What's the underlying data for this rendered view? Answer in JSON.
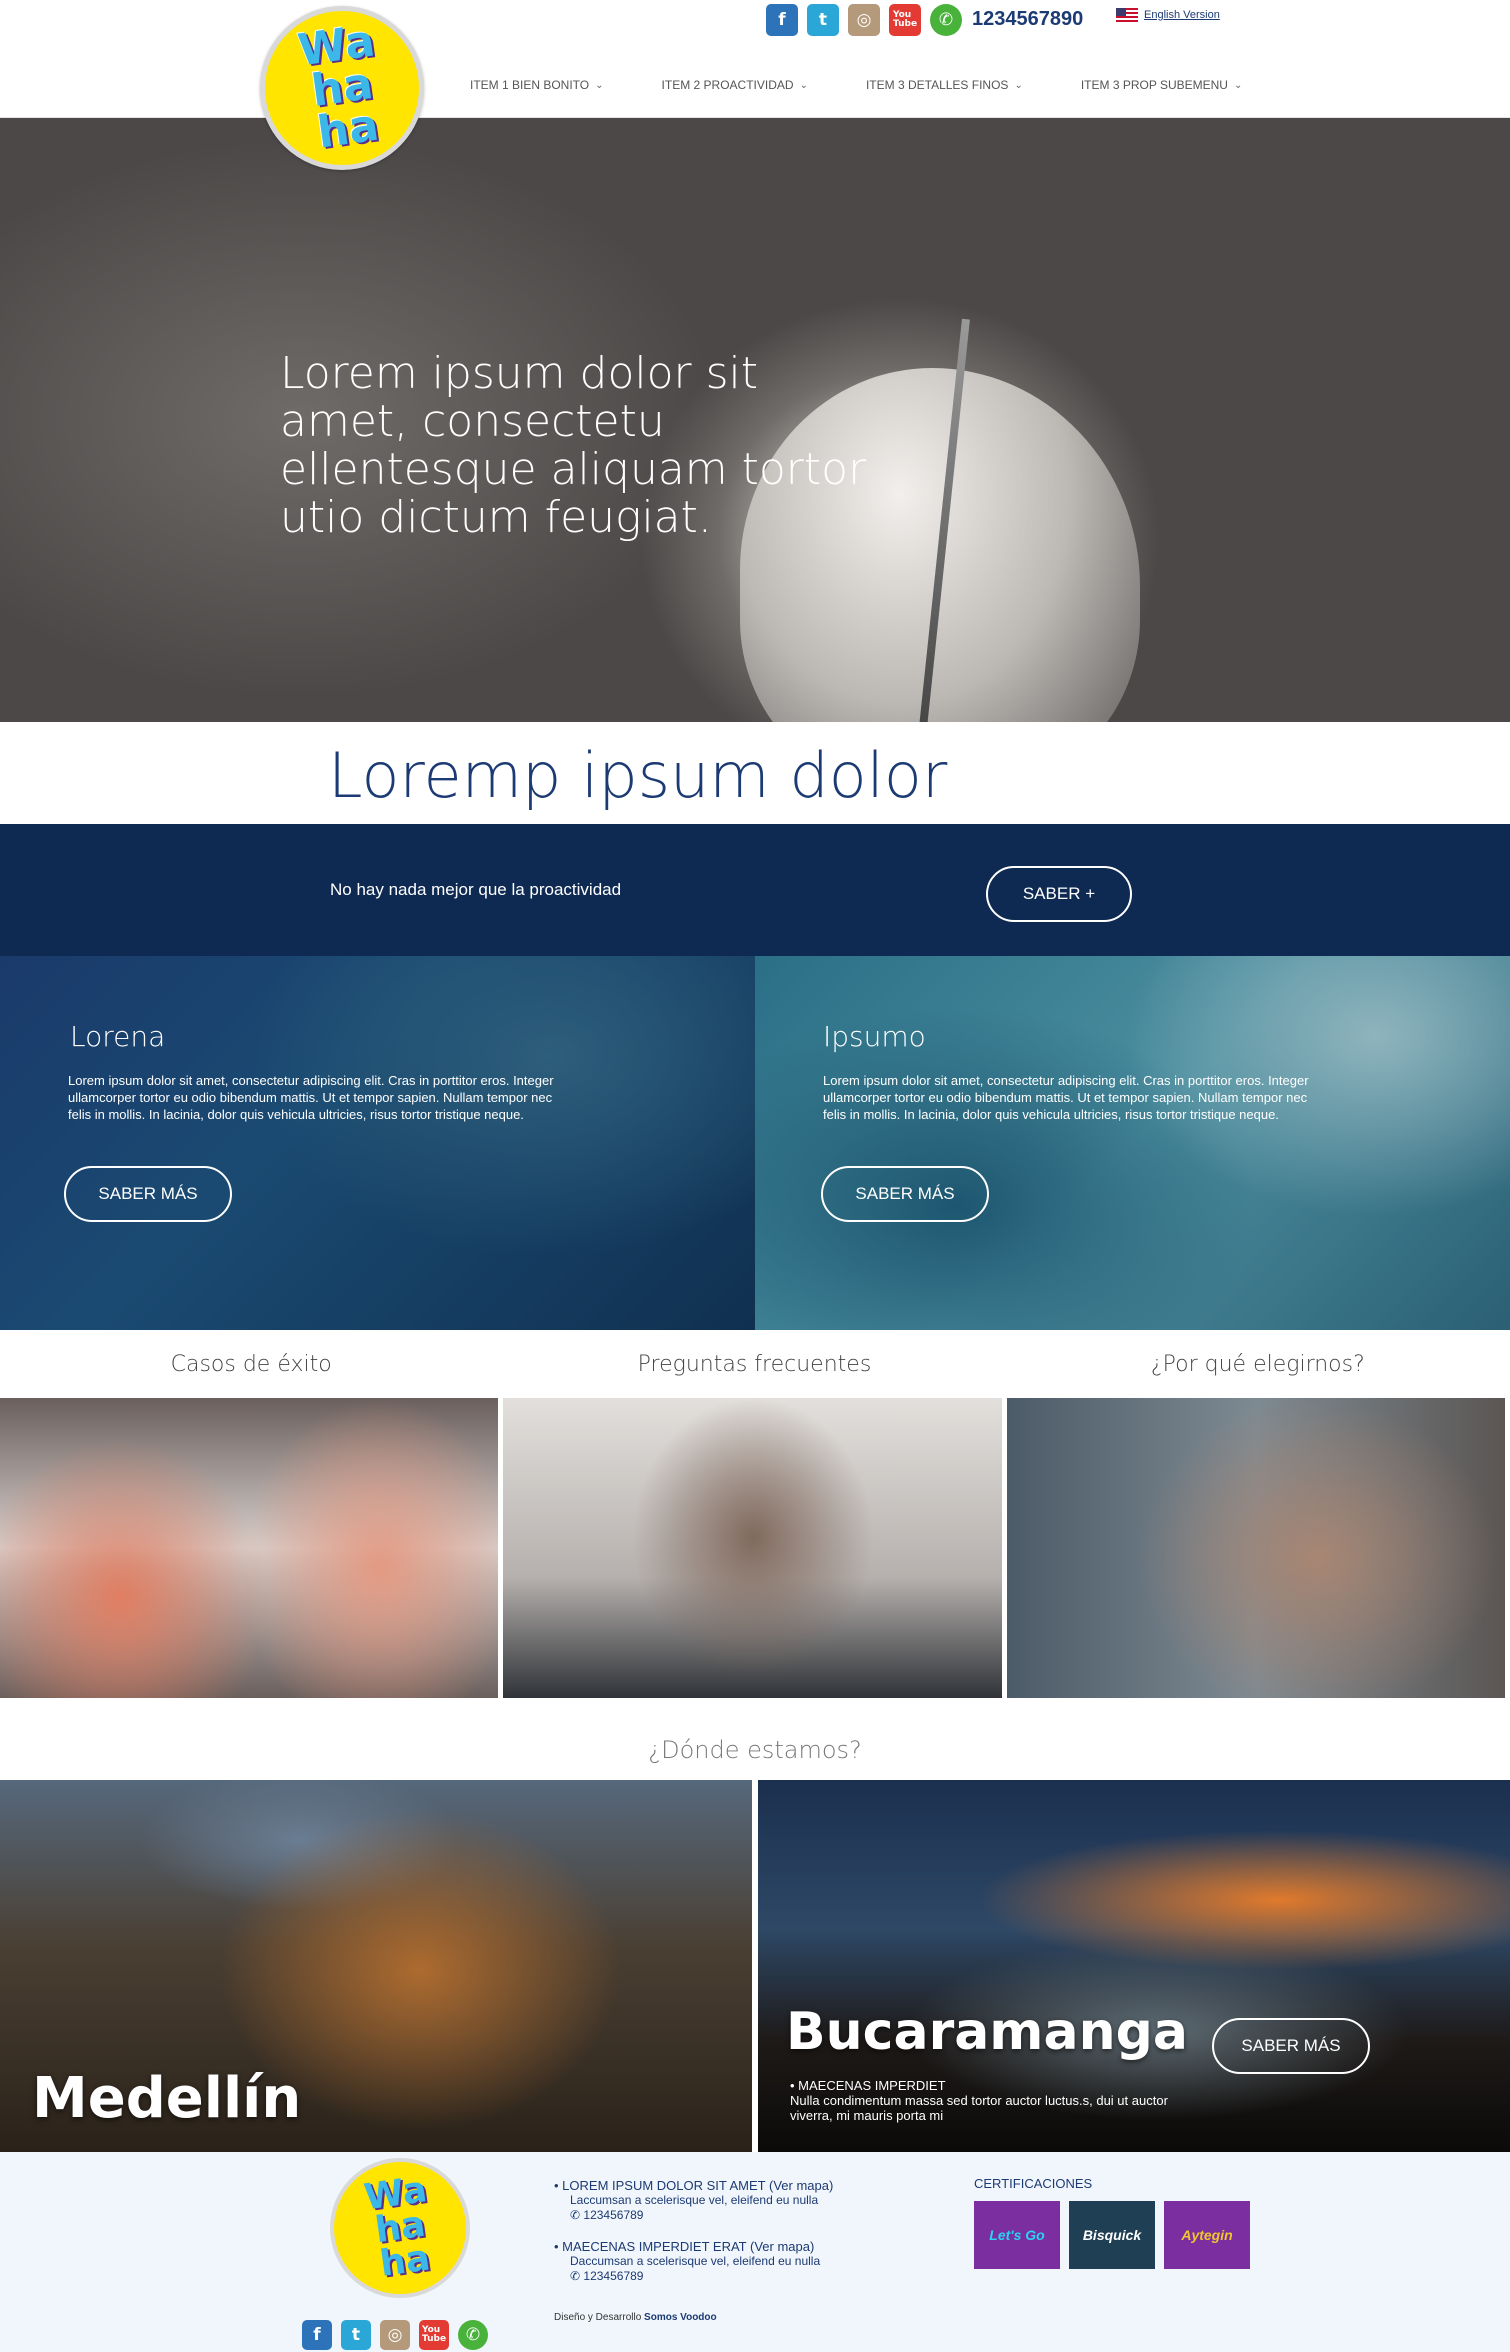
{
  "header": {
    "logo_text": "Wa\nha\nha",
    "phone": "1234567890",
    "language_link": "English Version",
    "social": [
      "facebook-icon",
      "twitter-icon",
      "instagram-icon",
      "youtube-icon",
      "whatsapp-icon"
    ],
    "nav": [
      {
        "label": "ITEM 1 BIEN BONITO"
      },
      {
        "label": "ITEM 2 PROACTIVIDAD"
      },
      {
        "label": "ITEM 3 DETALLES FINOS"
      },
      {
        "label": "ITEM 3 PROP SUBEMENU"
      }
    ]
  },
  "hero": {
    "headline": "Lorem ipsum dolor sit amet, consectetu ellentesque aliquam tortor utio dictum feugiat."
  },
  "section": {
    "title": "Loremp ipsum dolor"
  },
  "cta": {
    "text": "No hay nada mejor que la proactividad",
    "button": "SABER +"
  },
  "panels": [
    {
      "title": "Lorena",
      "body": "Lorem ipsum dolor sit amet, consectetur adipiscing elit. Cras in porttitor eros. Integer ullamcorper tortor eu odio bibendum mattis. Ut et tempor sapien. Nullam tempor nec felis in mollis. In lacinia, dolor quis vehicula ultricies, risus tortor tristique neque.",
      "button": "SABER MÁS"
    },
    {
      "title": "Ipsumo",
      "body": "Lorem ipsum dolor sit amet, consectetur adipiscing elit. Cras in porttitor eros. Integer ullamcorper tortor eu odio bibendum mattis. Ut et tempor sapien. Nullam tempor nec felis in mollis. In lacinia, dolor quis vehicula ultricies, risus tortor tristique neque.",
      "button": "SABER MÁS"
    }
  ],
  "cards": [
    {
      "label": "Casos de éxito"
    },
    {
      "label": "Preguntas frecuentes"
    },
    {
      "label": "¿Por qué elegirnos?"
    }
  ],
  "locations": {
    "title": "¿Dónde estamos?",
    "items": [
      {
        "name": "Medellín"
      },
      {
        "name": "Bucaramanga",
        "desc_title": "• MAECENAS IMPERDIET",
        "desc": "Nulla condimentum massa sed tortor auctor luctus.s, dui ut auctor viverra, mi mauris porta mi",
        "button": "SABER MÁS"
      }
    ]
  },
  "footer": {
    "addresses": [
      {
        "title": "• LOREM IPSUM DOLOR SIT AMET",
        "map": "(Ver mapa)",
        "line": "Laccumsan a scelerisque vel, eleifend eu nulla",
        "phone": "123456789"
      },
      {
        "title": "• MAECENAS IMPERDIET ERAT",
        "map": "(Ver mapa)",
        "line": "Daccumsan a scelerisque vel, eleifend eu nulla",
        "phone": "123456789"
      }
    ],
    "credit_prefix": "Diseño y Desarrollo",
    "credit_name": "Somos Voodoo",
    "certs_title": "CERTIFICACIONES",
    "certs": [
      "Let's Go",
      "Bisquick",
      "Aytegin"
    ]
  },
  "colors": {
    "navy": "#0e2a52",
    "brand_blue": "#1c3a73",
    "logo_yellow": "#ffe500"
  }
}
